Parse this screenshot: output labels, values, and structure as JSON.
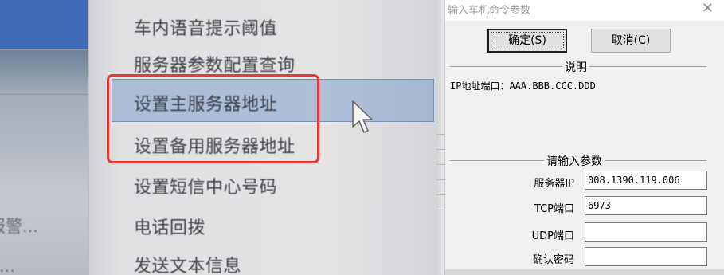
{
  "menu": {
    "items": [
      {
        "label": "车内语音提示阈值"
      },
      {
        "label": "服务器参数配置查询"
      },
      {
        "label": "设置主服务器地址"
      },
      {
        "label": "设置备用服务器地址"
      },
      {
        "label": "设置短信中心号码"
      },
      {
        "label": "电话回拨"
      },
      {
        "label": "发送文本信息"
      }
    ],
    "left_fragments": [
      "报警...",
      "务..."
    ],
    "highlight_color": "#e53a3a"
  },
  "dialog": {
    "title": "输入车机命令参数",
    "close_icon": "close-icon",
    "ok_label": "确定(S)",
    "cancel_label": "取消(C)",
    "explain_title": "说明",
    "explain_text": "IP地址端口：AAA.BBB.CCC.DDD",
    "params_title": "请输入参数",
    "fields": [
      {
        "label": "服务器IP",
        "value": "008.1390.119.006"
      },
      {
        "label": "TCP端口",
        "value": "6973"
      },
      {
        "label": "UDP端口",
        "value": ""
      },
      {
        "label": "确认密码",
        "value": ""
      }
    ]
  }
}
